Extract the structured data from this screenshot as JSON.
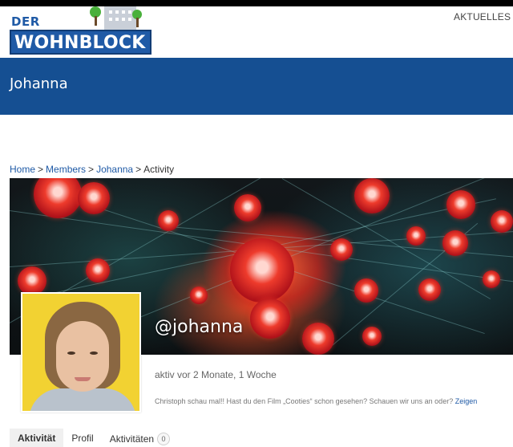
{
  "site": {
    "logo_top": "DER",
    "logo_main": "WOHNBLOCK",
    "nav_current": "AKTUELLES",
    "colors": {
      "brand_blue": "#1f5aa6",
      "title_bar": "#154f92",
      "avatar_bg": "#f2d232"
    }
  },
  "page": {
    "title": "Johanna"
  },
  "breadcrumb": {
    "items": [
      "Home",
      "Members",
      "Johanna",
      "Activity"
    ],
    "separator": ">"
  },
  "profile": {
    "handle": "@johanna",
    "last_active": "aktiv vor 2 Monate, 1 Woche",
    "latest_update": "Christoph schau mal!! Hast du den Film „Cooties“ schon gesehen? Schauen wir uns an oder?",
    "latest_update_link": "Zeigen"
  },
  "tabs": [
    {
      "label": "Aktivität",
      "active": true
    },
    {
      "label": "Profil",
      "active": false
    },
    {
      "label": "Aktivitäten",
      "count": "0",
      "active": false
    }
  ]
}
